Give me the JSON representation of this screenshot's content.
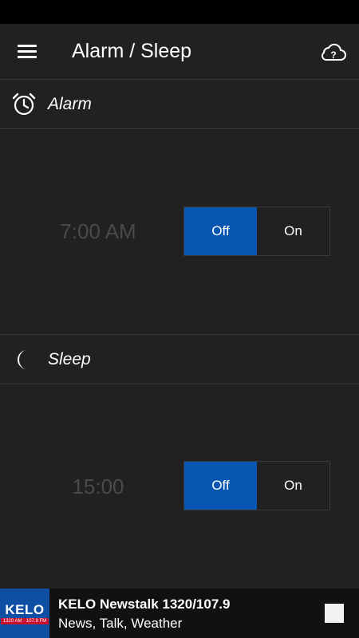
{
  "header": {
    "title": "Alarm / Sleep",
    "menu_icon": "hamburger-menu-icon",
    "help_icon": "cloud-help-icon"
  },
  "alarm": {
    "section_label": "Alarm",
    "icon": "alarm-clock-icon",
    "time": "7:00 AM",
    "toggle": {
      "off_label": "Off",
      "on_label": "On",
      "selected": "Off"
    }
  },
  "sleep": {
    "section_label": "Sleep",
    "icon": "moon-icon",
    "time": "15:00",
    "toggle": {
      "off_label": "Off",
      "on_label": "On",
      "selected": "Off"
    }
  },
  "player": {
    "logo_text": "KELO",
    "logo_subtext": "1320 AM · 107.9 FM",
    "station_name": "KELO Newstalk 1320/107.9",
    "tagline": "News, Talk, Weather",
    "stop_icon": "stop-icon"
  },
  "colors": {
    "background": "#212121",
    "accent": "#0a56b3",
    "divider": "#3a3a3a",
    "time_text": "#4a4a4a"
  }
}
